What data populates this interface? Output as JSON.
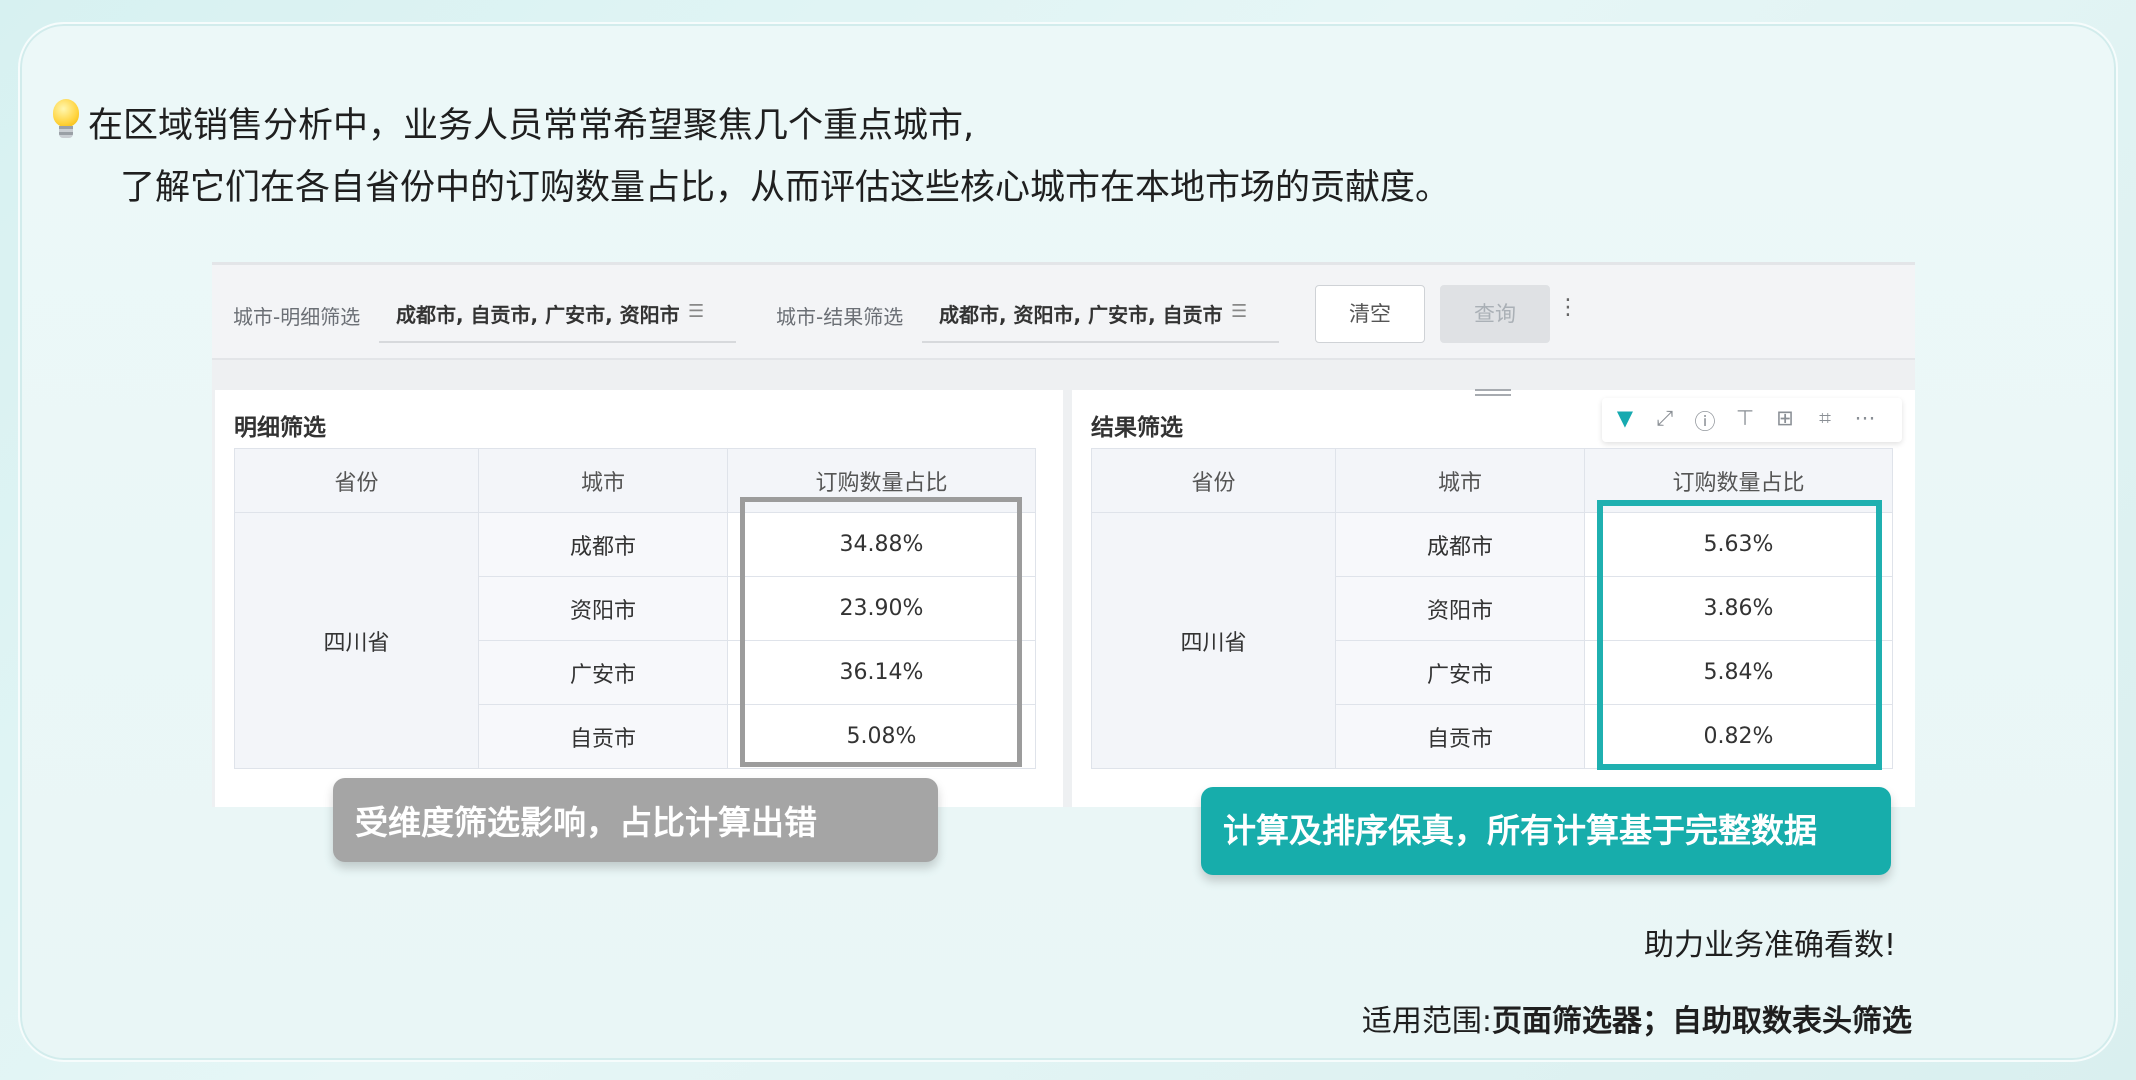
{
  "intro": {
    "line1": "在区域销售分析中，业务人员常常希望聚焦几个重点城市,",
    "line2": "了解它们在各自省份中的订购数量占比，从而评估这些核心城市在本地市场的贡献度。"
  },
  "filters": {
    "detail": {
      "label": "城市-明细筛选",
      "value": "成都市, 自贡市, 广安市, 资阳市"
    },
    "result": {
      "label": "城市-结果筛选",
      "value": "成都市, 资阳市, 广安市, 自贡市"
    },
    "clear_label": "清空",
    "query_label": "查询",
    "more_label": "⋮"
  },
  "left_panel": {
    "title": "明细筛选",
    "headers": [
      "省份",
      "城市",
      "订购数量占比"
    ],
    "province": "四川省",
    "rows": [
      {
        "city": "成都市",
        "ratio": "34.88%"
      },
      {
        "city": "资阳市",
        "ratio": "23.90%"
      },
      {
        "city": "广安市",
        "ratio": "36.14%"
      },
      {
        "city": "自贡市",
        "ratio": "5.08%"
      }
    ]
  },
  "right_panel": {
    "title": "结果筛选",
    "headers": [
      "省份",
      "城市",
      "订购数量占比"
    ],
    "province": "四川省",
    "rows": [
      {
        "city": "成都市",
        "ratio": "5.63%"
      },
      {
        "city": "资阳市",
        "ratio": "3.86%"
      },
      {
        "city": "广安市",
        "ratio": "5.84%"
      },
      {
        "city": "自贡市",
        "ratio": "0.82%"
      }
    ],
    "toolbar_icons": [
      "filter-icon",
      "expand-icon",
      "info-icon",
      "align-icon",
      "table-settings-icon",
      "format-painter-icon",
      "more-icon"
    ]
  },
  "callouts": {
    "left": "受维度筛选影响，占比计算出错",
    "right": "计算及排序保真，所有计算基于完整数据"
  },
  "footer": {
    "line1": "助力业务准确看数!",
    "scope_label": "适用范围:",
    "scope_value": "页面筛选器；自助取数表头筛选"
  },
  "colors": {
    "accent_teal": "#17adab",
    "callout_gray": "#a5a5a5",
    "highlight_gray": "#9c9c9c"
  }
}
